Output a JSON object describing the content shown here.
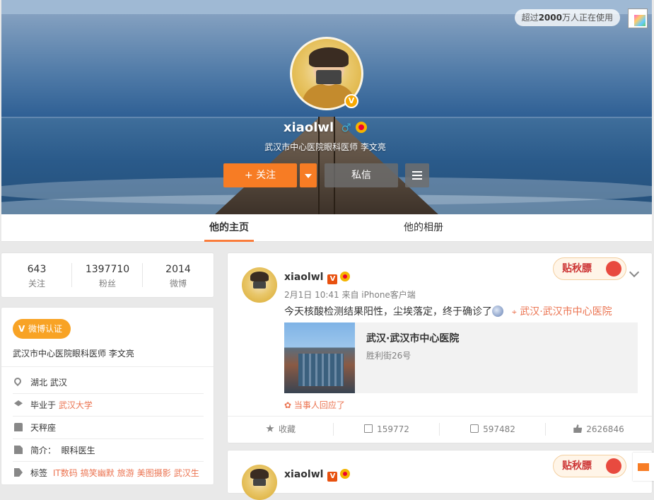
{
  "header": {
    "promo_text_prefix": "超过",
    "promo_text_bold": "2000",
    "promo_text_suffix": "万人正在使用",
    "username": "xiaolwl",
    "gender_icon": "♂",
    "bio": "武汉市中心医院眼科医师 李文亮",
    "follow_label": "+ 关注",
    "message_label": "私信",
    "verified_badge": "V"
  },
  "tabs": [
    {
      "label": "他的主页",
      "active": true
    },
    {
      "label": "他的相册",
      "active": false
    }
  ],
  "stats": [
    {
      "value": "643",
      "label": "关注"
    },
    {
      "value": "1397710",
      "label": "粉丝"
    },
    {
      "value": "2014",
      "label": "微博"
    }
  ],
  "profile": {
    "verify_badge": "微博认证",
    "verify_badge_icon": "V",
    "verify_text": "武汉市中心医院眼科医师 李文亮",
    "location": "湖北 武汉",
    "education_prefix": "毕业于",
    "education_school": "武汉大学",
    "birthday": "天秤座",
    "intro_label": "简介：",
    "intro_value": "眼科医生",
    "tags_label": "标签",
    "tags": [
      "IT数码",
      "搞笑幽默",
      "旅游",
      "美图摄影",
      "武汉生"
    ]
  },
  "post": {
    "user": "xiaolwl",
    "v_badge": "V",
    "time": "2月1日 10:41 来自 iPhone客户端",
    "text": "今天核酸检测结果阳性，尘埃落定，终于确诊了",
    "location_icon": "map-pin-icon",
    "location": "武汉·武汉市中心医院",
    "card_title": "武汉·武汉市中心医院",
    "card_subtitle": "胜利街26号",
    "reply_note": "当事人回应了",
    "autumn_badge": "贴秋膘",
    "actions": {
      "favorite": "收藏",
      "repost": "159772",
      "comment": "597482",
      "like": "2626846"
    }
  },
  "post2": {
    "user": "xiaolwl",
    "v_badge": "V",
    "autumn_badge": "贴秋膘"
  },
  "colors": {
    "accent": "#f77c24",
    "link": "#eb7350",
    "verify_gold": "#f8a325"
  }
}
